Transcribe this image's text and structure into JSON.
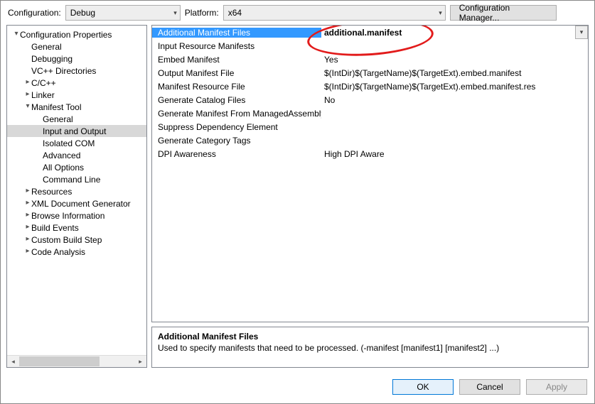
{
  "toolbar": {
    "config_label": "Configuration:",
    "config_value": "Debug",
    "platform_label": "Platform:",
    "platform_value": "x64",
    "cfgmgr_label": "Configuration Manager..."
  },
  "tree": [
    {
      "label": "Configuration Properties",
      "level": 0,
      "expander": "▾",
      "selected": false
    },
    {
      "label": "General",
      "level": 1,
      "expander": "",
      "selected": false
    },
    {
      "label": "Debugging",
      "level": 1,
      "expander": "",
      "selected": false
    },
    {
      "label": "VC++ Directories",
      "level": 1,
      "expander": "",
      "selected": false
    },
    {
      "label": "C/C++",
      "level": 1,
      "expander": "▸",
      "selected": false
    },
    {
      "label": "Linker",
      "level": 1,
      "expander": "▸",
      "selected": false
    },
    {
      "label": "Manifest Tool",
      "level": 1,
      "expander": "▾",
      "selected": false
    },
    {
      "label": "General",
      "level": 2,
      "expander": "",
      "selected": false
    },
    {
      "label": "Input and Output",
      "level": 2,
      "expander": "",
      "selected": true
    },
    {
      "label": "Isolated COM",
      "level": 2,
      "expander": "",
      "selected": false
    },
    {
      "label": "Advanced",
      "level": 2,
      "expander": "",
      "selected": false
    },
    {
      "label": "All Options",
      "level": 2,
      "expander": "",
      "selected": false
    },
    {
      "label": "Command Line",
      "level": 2,
      "expander": "",
      "selected": false
    },
    {
      "label": "Resources",
      "level": 1,
      "expander": "▸",
      "selected": false
    },
    {
      "label": "XML Document Generator",
      "level": 1,
      "expander": "▸",
      "selected": false
    },
    {
      "label": "Browse Information",
      "level": 1,
      "expander": "▸",
      "selected": false
    },
    {
      "label": "Build Events",
      "level": 1,
      "expander": "▸",
      "selected": false
    },
    {
      "label": "Custom Build Step",
      "level": 1,
      "expander": "▸",
      "selected": false
    },
    {
      "label": "Code Analysis",
      "level": 1,
      "expander": "▸",
      "selected": false
    }
  ],
  "grid": [
    {
      "name": "Additional Manifest Files",
      "value": "additional.manifest",
      "selected": true
    },
    {
      "name": "Input Resource Manifests",
      "value": ""
    },
    {
      "name": "Embed Manifest",
      "value": "Yes"
    },
    {
      "name": "Output Manifest File",
      "value": "$(IntDir)$(TargetName)$(TargetExt).embed.manifest"
    },
    {
      "name": "Manifest Resource File",
      "value": "$(IntDir)$(TargetName)$(TargetExt).embed.manifest.res"
    },
    {
      "name": "Generate Catalog Files",
      "value": "No"
    },
    {
      "name": "Generate Manifest From ManagedAssembly",
      "value": ""
    },
    {
      "name": "Suppress Dependency Element",
      "value": ""
    },
    {
      "name": "Generate Category Tags",
      "value": ""
    },
    {
      "name": "DPI Awareness",
      "value": "High DPI Aware"
    }
  ],
  "description": {
    "title": "Additional Manifest Files",
    "body": "Used to specify manifests that need to be processed. (-manifest [manifest1] [manifest2] ...)"
  },
  "buttons": {
    "ok": "OK",
    "cancel": "Cancel",
    "apply": "Apply"
  },
  "annotation_color": "#e21b1b"
}
